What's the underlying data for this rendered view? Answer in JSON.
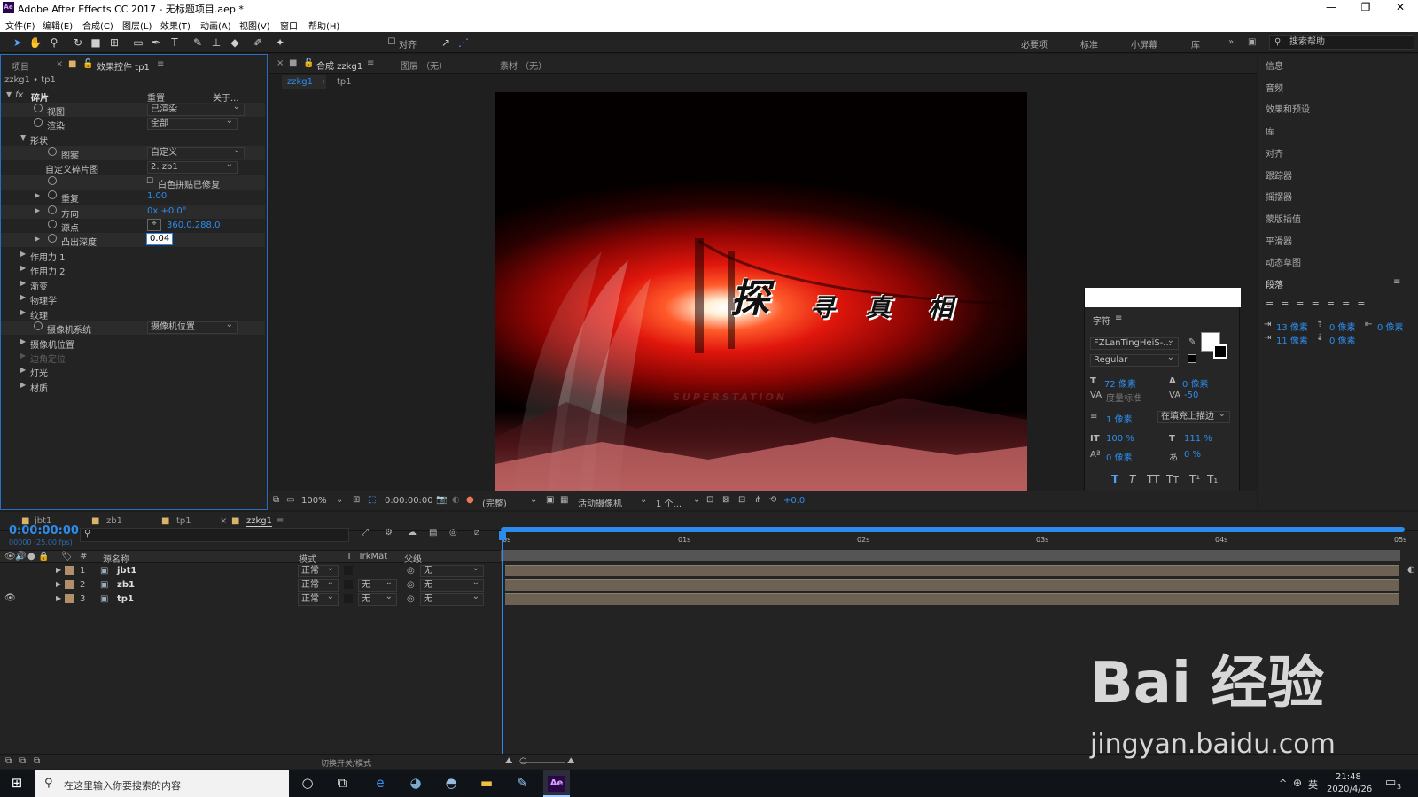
{
  "window": {
    "title": "Adobe After Effects CC 2017 - 无标题项目.aep *",
    "logo": "Ae"
  },
  "menu": [
    "文件(F)",
    "编辑(E)",
    "合成(C)",
    "图层(L)",
    "效果(T)",
    "动画(A)",
    "视图(V)",
    "窗口",
    "帮助(H)"
  ],
  "toolbar": {
    "align_label": "对齐",
    "workspaces": [
      "必要项",
      "标准",
      "小屏幕",
      "库"
    ],
    "search_placeholder": "搜索帮助"
  },
  "left_panel": {
    "tabs": [
      "项目",
      "效果控件 tp1"
    ],
    "breadcrumb": "zzkg1 • tp1",
    "effect_name": "碎片",
    "reset": "重置",
    "about": "关于...",
    "props": [
      {
        "label": "视图",
        "value": "已渲染"
      },
      {
        "label": "渲染",
        "value": "全部"
      },
      {
        "label": "形状",
        "value": ""
      },
      {
        "label": "图案",
        "value": "自定义"
      },
      {
        "label": "自定义碎片图",
        "value": "2. zb1"
      },
      {
        "label": "白色拼贴已修复",
        "value": ""
      },
      {
        "label": "重复",
        "value": "1.00"
      },
      {
        "label": "方向",
        "value": "0x +0.0°"
      },
      {
        "label": "源点",
        "value": "360.0,288.0"
      },
      {
        "label": "凸出深度",
        "value": "0.04"
      },
      {
        "label": "作用力 1",
        "value": ""
      },
      {
        "label": "作用力 2",
        "value": ""
      },
      {
        "label": "渐变",
        "value": ""
      },
      {
        "label": "物理学",
        "value": ""
      },
      {
        "label": "纹理",
        "value": ""
      },
      {
        "label": "摄像机系统",
        "value": "摄像机位置"
      },
      {
        "label": "摄像机位置",
        "value": ""
      },
      {
        "label": "边角定位",
        "value": ""
      },
      {
        "label": "灯光",
        "value": ""
      },
      {
        "label": "材质",
        "value": ""
      }
    ]
  },
  "comp_panel": {
    "tabs": [
      "合成 zzkg1",
      "图层 （无）",
      "素材 （无）"
    ],
    "subtabs": [
      "zzkg1",
      "tp1"
    ],
    "title_text": [
      "探",
      "寻",
      "真",
      "相"
    ],
    "faint_text": "SUPERSTATION",
    "bottom": {
      "zoom": "100%",
      "timecode": "0:00:00:00",
      "quality": "(完整)",
      "camera": "活动摄像机",
      "views": "1 个...",
      "exposure": "+0.0"
    }
  },
  "character_panel": {
    "title": "字符",
    "font": "FZLanTingHeiS-...",
    "style": "Regular",
    "size": "72 像素",
    "leading": "0 像素",
    "kerning": "度量标准",
    "tracking": "-50",
    "stroke": "1 像素",
    "stroke_type": "在填充上描边",
    "v_scale": "100 %",
    "h_scale": "111 %",
    "baseline": "0 像素",
    "tsume": "0 %",
    "styles": [
      "T",
      "T",
      "TT",
      "Tт",
      "T¹",
      "T₁"
    ]
  },
  "right_panel": {
    "items": [
      "信息",
      "音频",
      "效果和预设",
      "库",
      "对齐",
      "跟踪器",
      "摇摆器",
      "蒙版插值",
      "平滑器",
      "动态草图",
      "段落"
    ],
    "para_values": [
      "13 像素",
      "0 像素",
      "0 像素",
      "11 像素",
      "0 像素"
    ]
  },
  "timeline": {
    "tabs": [
      "jbt1",
      "zb1",
      "tp1",
      "zzkg1"
    ],
    "timecode": "0:00:00:00",
    "fps": "00000 (25.00 fps)",
    "search_placeholder": "",
    "columns": [
      "源名称",
      "模式",
      "T",
      "TrkMat",
      "父级"
    ],
    "layers": [
      {
        "num": "1",
        "name": "jbt1",
        "mode": "正常",
        "trkmat": "",
        "parent": "无"
      },
      {
        "num": "2",
        "name": "zb1",
        "mode": "正常",
        "trkmat": "无",
        "parent": "无"
      },
      {
        "num": "3",
        "name": "tp1",
        "mode": "正常",
        "trkmat": "无",
        "parent": "无"
      }
    ],
    "ruler": [
      "0s",
      "01s",
      "02s",
      "03s",
      "04s",
      "05s"
    ],
    "footer": "切换开关/模式"
  },
  "watermark": {
    "brand": "Bai 经验",
    "url": "jingyan.baidu.com"
  },
  "taskbar": {
    "search": "在这里输入你要搜索的内容",
    "time": "21:48",
    "date": "2020/4/26",
    "lang": "英",
    "notif": "3"
  }
}
